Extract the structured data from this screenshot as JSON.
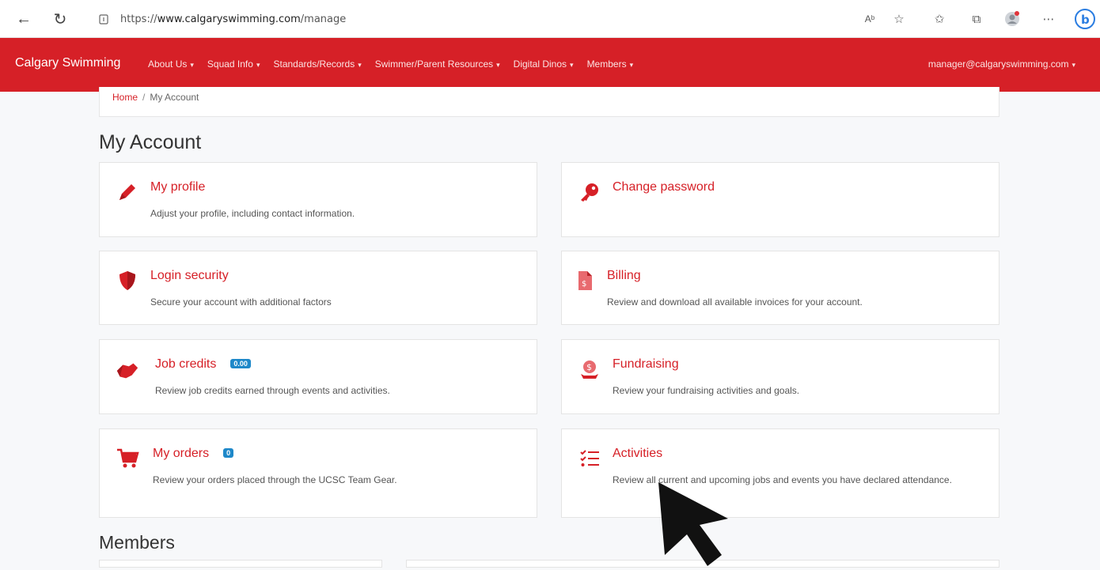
{
  "browser": {
    "url_prefix": "https://",
    "url_host": "www.calgaryswimming.com",
    "url_path": "/manage"
  },
  "nav": {
    "brand": "Calgary Swimming",
    "items": [
      {
        "label": "About Us"
      },
      {
        "label": "Squad Info"
      },
      {
        "label": "Standards/Records"
      },
      {
        "label": "Swimmer/Parent Resources"
      },
      {
        "label": "Digital Dinos"
      },
      {
        "label": "Members"
      }
    ],
    "user": "manager@calgaryswimming.com",
    "accent": "#d62027"
  },
  "breadcrumb": {
    "home": "Home",
    "sep": "/",
    "current": "My Account"
  },
  "page": {
    "title": "My Account",
    "members_title": "Members"
  },
  "cards": {
    "profile": {
      "title": "My profile",
      "desc": "Adjust your profile, including contact information.",
      "icon": "pencil-icon"
    },
    "password": {
      "title": "Change password",
      "desc": "",
      "icon": "key-icon"
    },
    "security": {
      "title": "Login security",
      "desc": "Secure your account with additional factors",
      "icon": "shield-icon"
    },
    "billing": {
      "title": "Billing",
      "desc": "Review and download all available invoices for your account.",
      "icon": "invoice-icon"
    },
    "jobs": {
      "title": "Job credits",
      "badge": "0.00",
      "desc": "Review job credits earned through events and activities.",
      "icon": "handshake-icon"
    },
    "fundraising": {
      "title": "Fundraising",
      "desc": "Review your fundraising activities and goals.",
      "icon": "money-hand-icon"
    },
    "orders": {
      "title": "My orders",
      "badge": "0",
      "desc": "Review your orders placed through the UCSC Team Gear.",
      "icon": "cart-icon"
    },
    "activities": {
      "title": "Activities",
      "desc": "Review all current and upcoming jobs and events you have declared attendance.",
      "icon": "checklist-icon"
    }
  }
}
